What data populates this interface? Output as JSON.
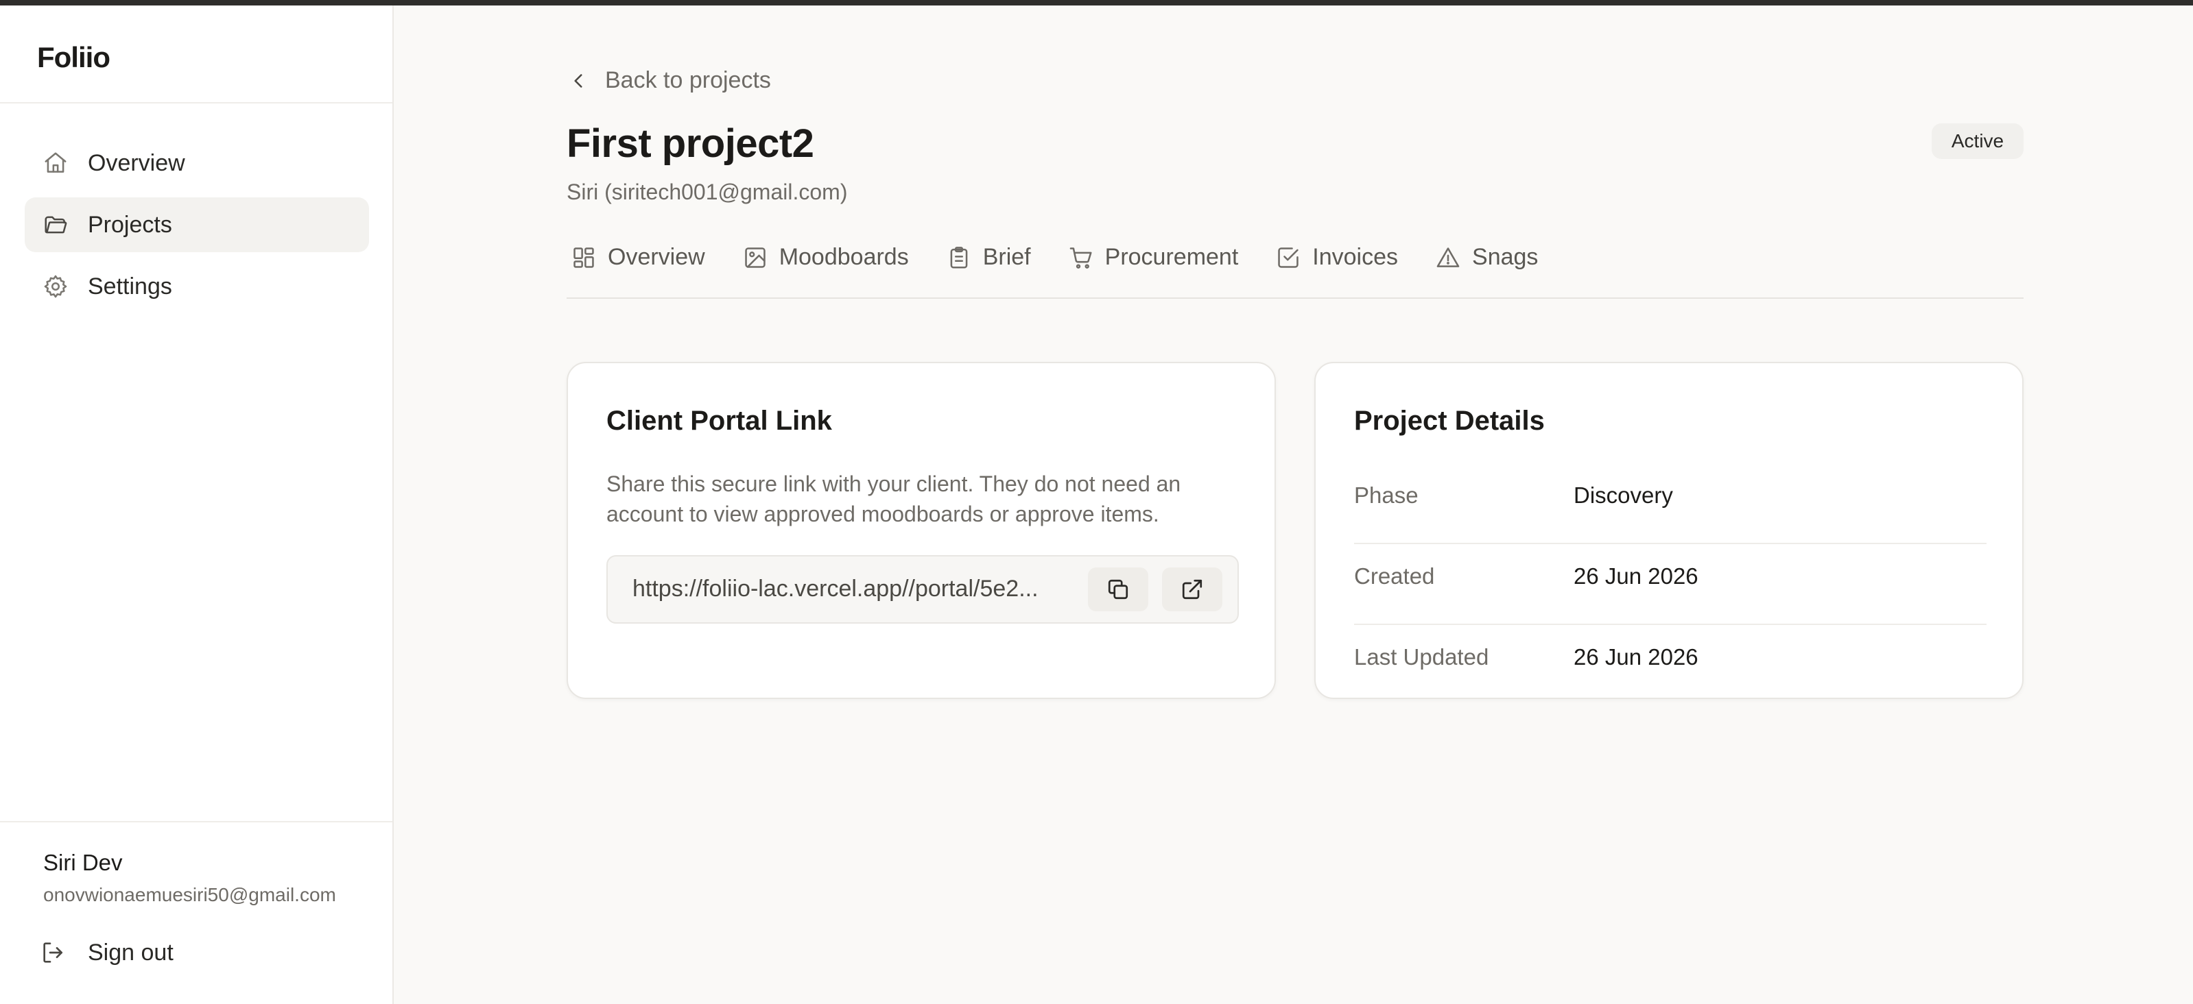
{
  "app": {
    "brand": "Foliio"
  },
  "sidebar": {
    "items": [
      {
        "label": "Overview",
        "icon": "home-icon"
      },
      {
        "label": "Projects",
        "icon": "folder-icon"
      },
      {
        "label": "Settings",
        "icon": "gear-icon"
      }
    ],
    "user": {
      "name": "Siri Dev",
      "email": "onovwionaemuesiri50@gmail.com"
    },
    "signout_label": "Sign out"
  },
  "header": {
    "back_label": "Back to projects",
    "title": "First project2",
    "subtitle": "Siri (siritech001@gmail.com)",
    "status": "Active"
  },
  "tabs": [
    {
      "label": "Overview",
      "icon": "grid-icon"
    },
    {
      "label": "Moodboards",
      "icon": "image-icon"
    },
    {
      "label": "Brief",
      "icon": "clipboard-icon"
    },
    {
      "label": "Procurement",
      "icon": "cart-icon"
    },
    {
      "label": "Invoices",
      "icon": "check-square-icon"
    },
    {
      "label": "Snags",
      "icon": "warning-icon"
    }
  ],
  "portal_card": {
    "title": "Client Portal Link",
    "description": "Share this secure link with your client. They do not need an account to view approved moodboards or approve items.",
    "link": "https://foliio-lac.vercel.app//portal/5e2..."
  },
  "details_card": {
    "title": "Project Details",
    "rows": [
      {
        "label": "Phase",
        "value": "Discovery"
      },
      {
        "label": "Created",
        "value": "26 Jun 2026"
      },
      {
        "label": "Last Updated",
        "value": "26 Jun 2026"
      }
    ]
  },
  "colors": {
    "background": "#faf9f7",
    "sidebar": "#ffffff",
    "active_nav": "#f3f2ef",
    "text": "#1c1b19",
    "muted": "#6e6b66"
  }
}
